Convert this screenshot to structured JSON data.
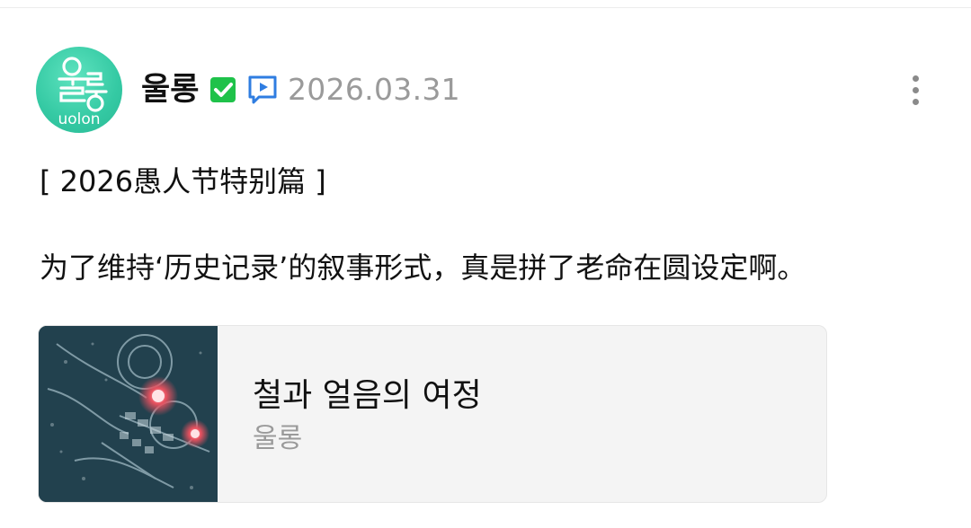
{
  "post": {
    "author": "울롱",
    "date": "2026.03.31",
    "title": "[ 2026愚人节特别篇 ]",
    "body": "为了维持‘历史记录’的叙事形式，真是拼了老命在圆设定啊。"
  },
  "avatar": {
    "logo_text": "uolon",
    "logo_glyph": "울롱",
    "color": "#34c9a3"
  },
  "icons": {
    "verified": "verified-check-icon",
    "video": "video-play-icon",
    "more": "more-vertical-icon"
  },
  "colors": {
    "verified_green": "#1fc24a",
    "video_blue": "#2f7de1",
    "muted_text": "#9a9a9a"
  },
  "link_card": {
    "title": "철과 얼음의 여정",
    "subtitle": "울롱"
  }
}
